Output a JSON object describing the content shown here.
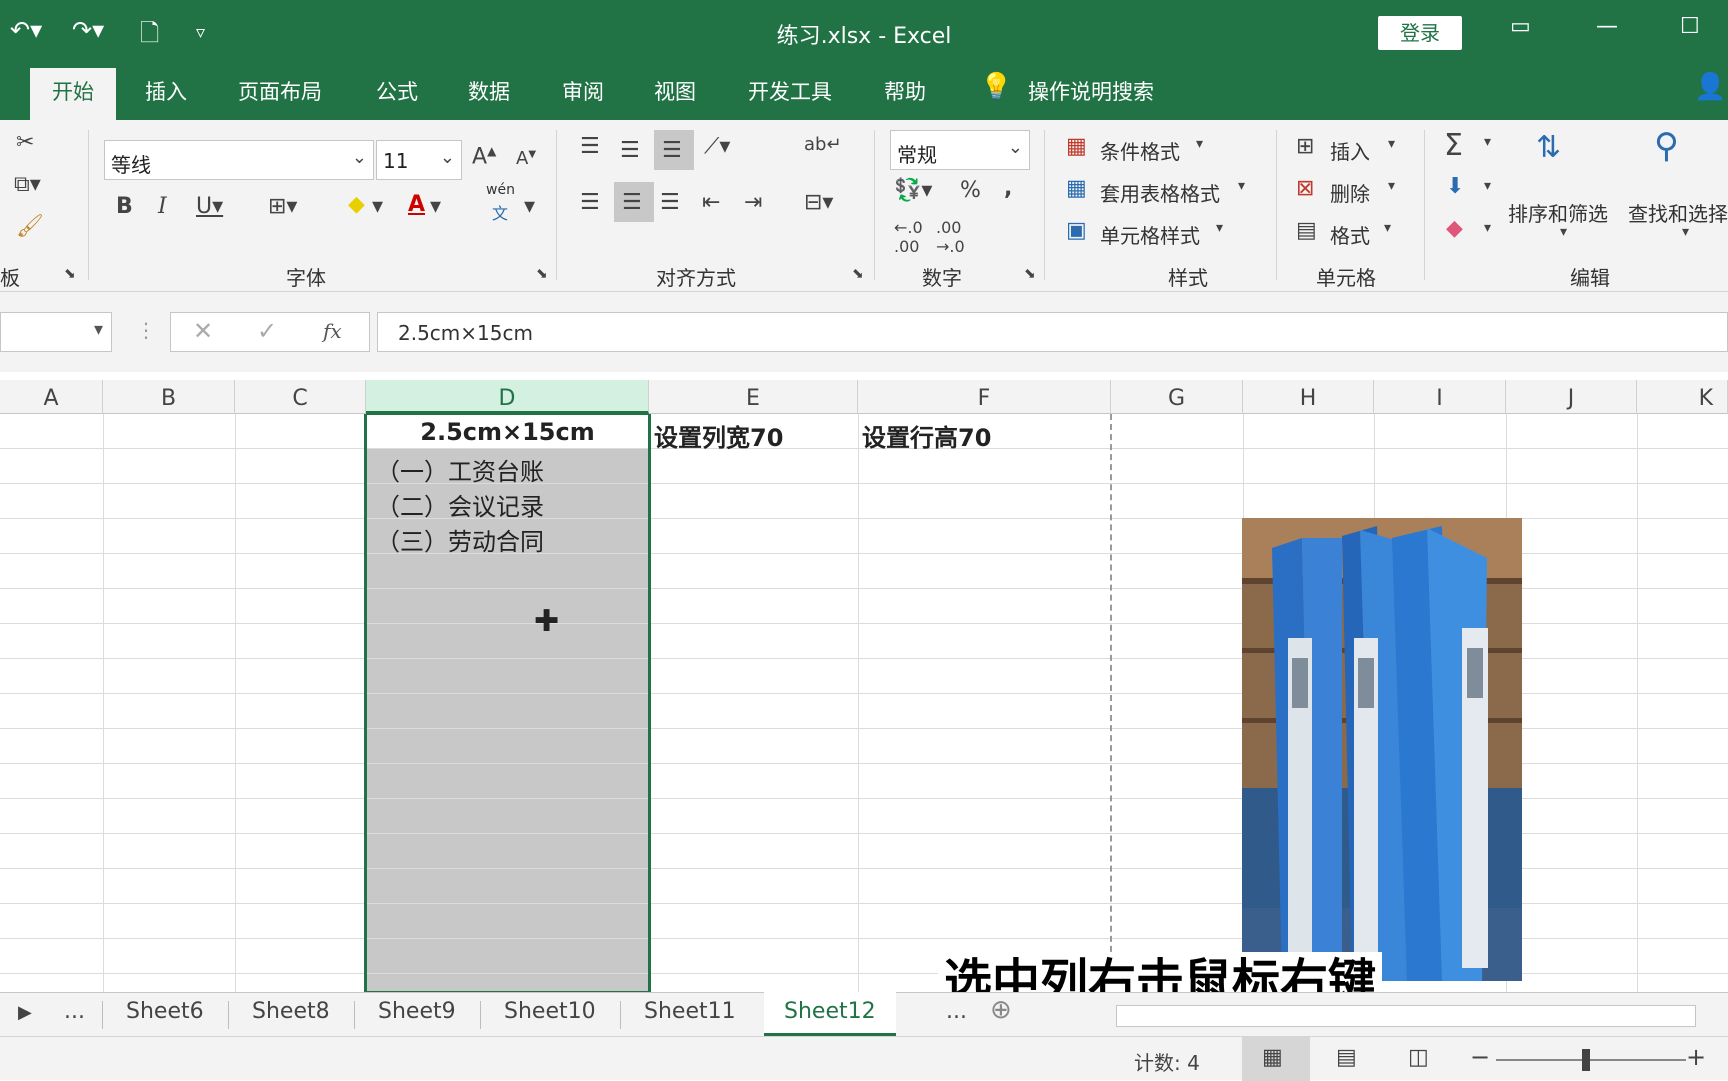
{
  "window": {
    "title": "练习.xlsx  -  Excel",
    "login_label": "登录"
  },
  "tabs": [
    "开始",
    "插入",
    "页面布局",
    "公式",
    "数据",
    "审阅",
    "视图",
    "开发工具",
    "帮助"
  ],
  "tell_me": "操作说明搜索",
  "ribbon": {
    "clipboard_label": "板",
    "font_name": "等线",
    "font_size": "11",
    "font_group_label": "字体",
    "wen_label": "wén",
    "wen_char": "文",
    "align_group_label": "对齐方式",
    "number_format": "常规",
    "number_group_label": "数字",
    "styles": {
      "conditional": "条件格式",
      "table_format": "套用表格格式",
      "cell_styles": "单元格样式",
      "label": "样式"
    },
    "cells": {
      "insert": "插入",
      "delete": "删除",
      "format": "格式",
      "label": "单元格"
    },
    "editing": {
      "sort_filter": "排序和筛选",
      "find_select": "查找和选择",
      "label": "编辑"
    }
  },
  "formula": {
    "fx": "fx",
    "value": "2.5cm×15cm"
  },
  "columns": [
    "A",
    "B",
    "C",
    "D",
    "E",
    "F",
    "G",
    "H",
    "I",
    "J",
    "K"
  ],
  "cells": {
    "d1": "2.5cm×15cm",
    "e1": "设置列宽70",
    "f1": "设置行高70",
    "d2": "（一）工资台账",
    "d3": "（二）会议记录",
    "d4": "（三）劳动合同"
  },
  "sheets": [
    "Sheet6",
    "Sheet8",
    "Sheet9",
    "Sheet10",
    "Sheet11",
    "Sheet12"
  ],
  "sheet_overflow": "...",
  "active_sheet": "Sheet12",
  "status": {
    "count": "计数: 4"
  },
  "subtitle": "选中列右击鼠标右键"
}
